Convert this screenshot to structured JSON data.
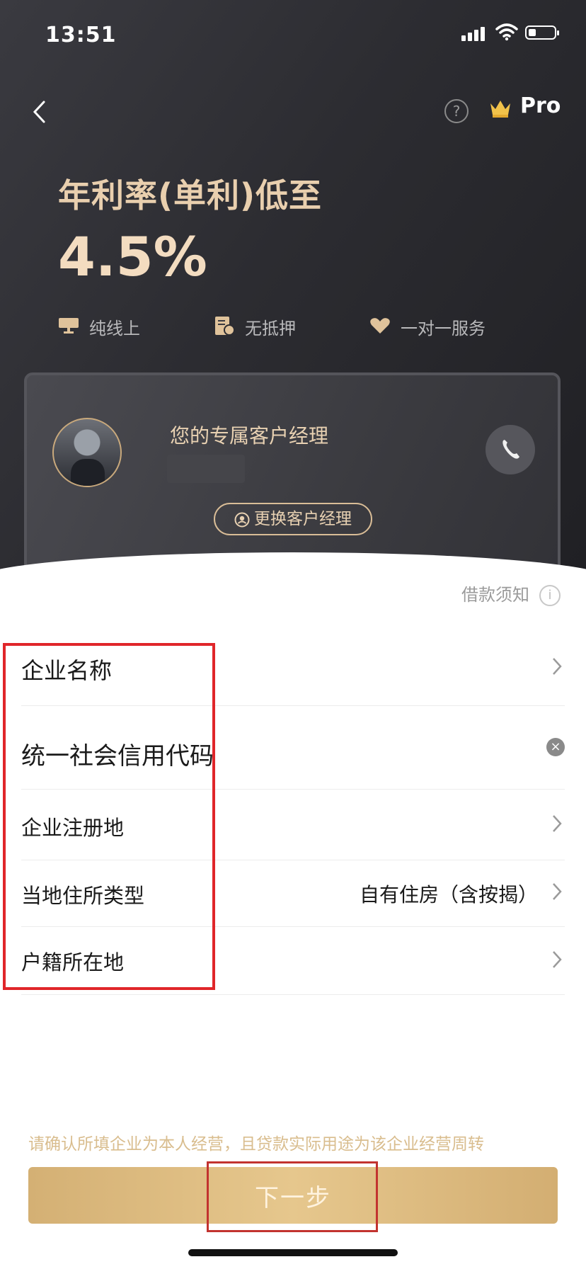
{
  "status_bar": {
    "time": "13:51"
  },
  "header": {
    "pro_label": "Pro",
    "help_symbol": "?"
  },
  "hero": {
    "title": "年利率(单利)低至",
    "rate": "4.5%"
  },
  "features": [
    {
      "icon": "monitor-icon",
      "label": "纯线上"
    },
    {
      "icon": "no-collateral-icon",
      "label": "无抵押"
    },
    {
      "icon": "heart-service-icon",
      "label": "一对一服务"
    }
  ],
  "manager_card": {
    "label": "您的专属客户经理",
    "change_button": "更换客户经理"
  },
  "loan_notice": {
    "label": "借款须知",
    "icon_symbol": "i"
  },
  "form": {
    "rows": [
      {
        "label": "企业名称",
        "value": ""
      },
      {
        "label": "统一社会信用代码",
        "value": ""
      },
      {
        "label": "企业注册地",
        "value": ""
      },
      {
        "label": "当地住所类型",
        "value": "自有住房（含按揭）"
      },
      {
        "label": "户籍所在地",
        "value": ""
      }
    ]
  },
  "footer": {
    "confirm_text": "请确认所填企业为本人经营，且贷款实际用途为该企业经营周转",
    "next_button": "下一步"
  },
  "colors": {
    "gold": "#e6c78d",
    "dark_bg": "#2c2c31",
    "highlight_red": "#e0262a"
  }
}
